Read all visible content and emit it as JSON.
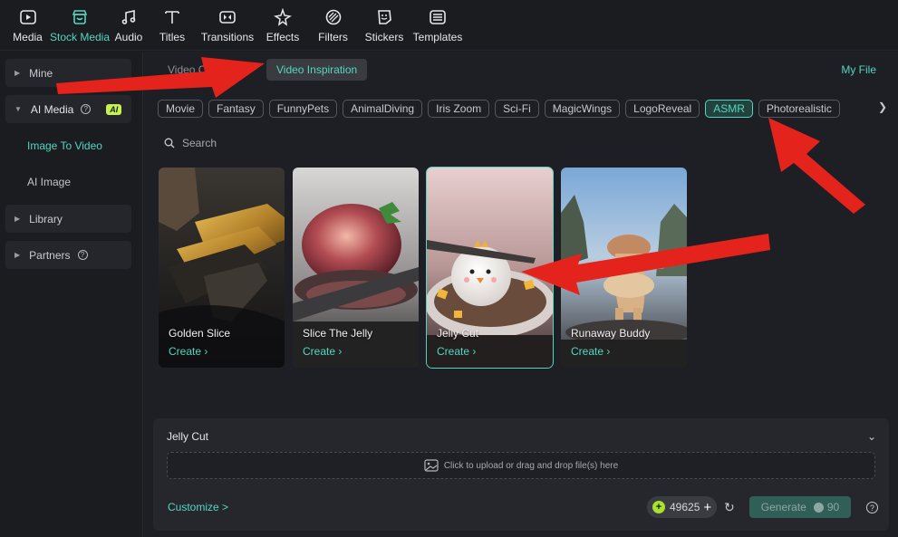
{
  "toolbar": {
    "items": [
      {
        "label": "Media",
        "icon": "media-icon"
      },
      {
        "label": "Stock Media",
        "icon": "stock-media-icon",
        "active": true
      },
      {
        "label": "Audio",
        "icon": "music-note-icon"
      },
      {
        "label": "Titles",
        "icon": "text-t-icon"
      },
      {
        "label": "Transitions",
        "icon": "transitions-icon"
      },
      {
        "label": "Effects",
        "icon": "effects-sparkle-icon"
      },
      {
        "label": "Filters",
        "icon": "filters-icon"
      },
      {
        "label": "Stickers",
        "icon": "sticker-icon"
      },
      {
        "label": "Templates",
        "icon": "templates-icon"
      }
    ]
  },
  "sidebar": {
    "mine": "Mine",
    "ai_media": "AI Media",
    "ai_badge": "AI",
    "image_to_video": "Image To Video",
    "ai_image": "AI Image",
    "library": "Library",
    "partners": "Partners"
  },
  "main": {
    "tab_video_creation": "Video C",
    "tab_video_inspiration": "Video Inspiration",
    "my_file": "My File",
    "chips": [
      "Movie",
      "Fantasy",
      "FunnyPets",
      "AnimalDiving",
      "Iris Zoom",
      "Sci-Fi",
      "MagicWings",
      "LogoReveal",
      "ASMR",
      "Photorealistic"
    ],
    "selected_chip": "ASMR",
    "search_placeholder": "Search",
    "cards": [
      {
        "title": "Golden Slice",
        "create": "Create"
      },
      {
        "title": "Slice The Jelly",
        "create": "Create"
      },
      {
        "title": "Jelly Cut",
        "create": "Create"
      },
      {
        "title": "Runaway Buddy",
        "create": "Create"
      }
    ]
  },
  "panel": {
    "title": "Jelly Cut",
    "upload_text": "Click to upload or drag and drop file(s) here",
    "customize": "Customize >",
    "credits": "49625",
    "generate_label": "Generate",
    "generate_cost": "90"
  },
  "colors": {
    "accent": "#54d6c0",
    "annotation_arrow": "#e5231d"
  }
}
